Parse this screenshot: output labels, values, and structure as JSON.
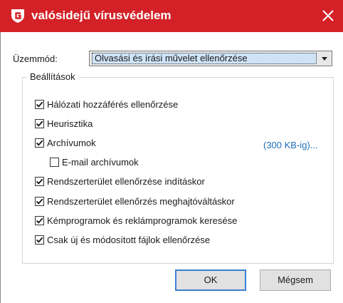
{
  "window": {
    "title": "valósidejű vírusvédelem",
    "title_bg": "#d32127",
    "logo_icon": "g-shield-logo-icon",
    "close_icon": "close-icon"
  },
  "mode": {
    "label": "Üzemmód:",
    "selected": "Olvasási és írási művelet ellenőrzése"
  },
  "settings": {
    "group_label": "Beállítások",
    "options": [
      {
        "label": "Hálózati hozzáférés ellenőrzése",
        "checked": true
      },
      {
        "label": "Heurisztika",
        "checked": true
      },
      {
        "label": "Archívumok",
        "checked": true
      },
      {
        "label": "E-mail archívumok",
        "checked": false
      },
      {
        "label": "Rendszerterület ellenőrzése indításkor",
        "checked": true
      },
      {
        "label": "Rendszerterület ellenőrzés meghajtóváltáskor",
        "checked": true
      },
      {
        "label": "Kémprogramok és reklámprogramok keresése",
        "checked": true
      },
      {
        "label": "Csak új és módosított fájlok ellenőrzése",
        "checked": true
      }
    ],
    "archive_limit_link": "(300 KB-ig)...",
    "link_color": "#1f6fb8"
  },
  "buttons": {
    "ok": "OK",
    "cancel": "Mégsem"
  }
}
